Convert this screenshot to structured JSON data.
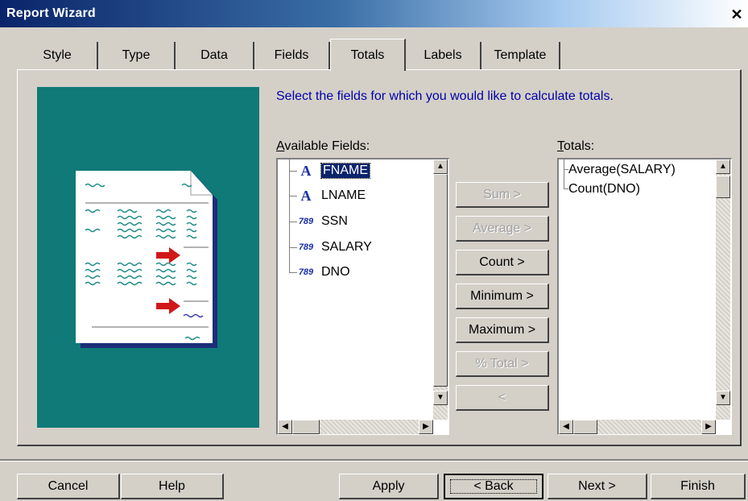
{
  "window": {
    "title": "Report Wizard",
    "close_glyph": "✕"
  },
  "tabs": [
    {
      "label": "Style"
    },
    {
      "label": "Type"
    },
    {
      "label": "Data"
    },
    {
      "label": "Fields"
    },
    {
      "label": "Totals",
      "active": true
    },
    {
      "label": "Labels"
    },
    {
      "label": "Template"
    }
  ],
  "instruction": "Select the fields for which you would like to calculate totals.",
  "available": {
    "label_first": "A",
    "label_rest": "vailable Fields:",
    "items": [
      {
        "label": "FNAME",
        "icon": "text-field-icon",
        "glyph": "A",
        "selected": true
      },
      {
        "label": "LNAME",
        "icon": "text-field-icon",
        "glyph": "A"
      },
      {
        "label": "SSN",
        "icon": "number-field-icon",
        "glyph": "789"
      },
      {
        "label": "SALARY",
        "icon": "number-field-icon",
        "glyph": "789"
      },
      {
        "label": "DNO",
        "icon": "number-field-icon",
        "glyph": "789"
      }
    ]
  },
  "totals": {
    "label_first": "T",
    "label_rest": "otals:",
    "items": [
      "Average(SALARY)",
      "Count(DNO)"
    ]
  },
  "actions": [
    {
      "label": "Sum >",
      "enabled": false
    },
    {
      "label": "Average >",
      "enabled": false
    },
    {
      "label": "Count >",
      "enabled": true
    },
    {
      "label": "Minimum >",
      "enabled": true
    },
    {
      "label": "Maximum >",
      "enabled": true
    },
    {
      "label": "% Total >",
      "enabled": false
    },
    {
      "label": "<",
      "enabled": false
    }
  ],
  "footer": {
    "cancel": "Cancel",
    "help": "Help",
    "apply": "Apply",
    "back": "< Back",
    "next": "Next >",
    "finish": "Finish"
  },
  "scroll_glyphs": {
    "up": "▲",
    "down": "▼",
    "left": "◀",
    "right": "▶"
  },
  "colors": {
    "preview_bg": "#0f7a78",
    "instruction_text": "#0000aa",
    "selection": "#0a246a"
  }
}
